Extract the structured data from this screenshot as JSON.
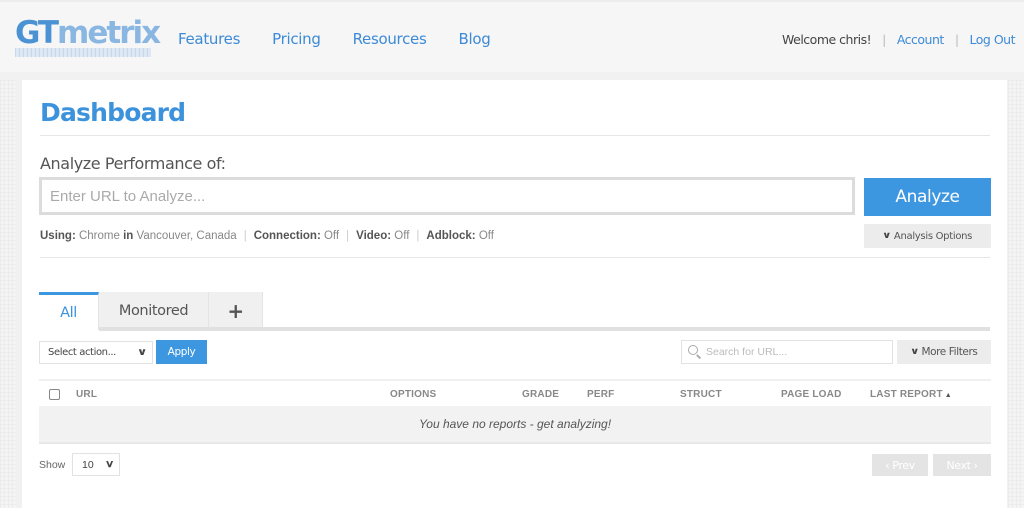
{
  "header": {
    "logo": {
      "part1": "GT",
      "part2": "metrix"
    },
    "nav": [
      "Features",
      "Pricing",
      "Resources",
      "Blog"
    ],
    "welcome": "Welcome chris!",
    "account_link": "Account",
    "logout_link": "Log Out",
    "separator": "|"
  },
  "page": {
    "title": "Dashboard",
    "analyze_label": "Analyze Performance of:",
    "url_placeholder": "Enter URL to Analyze...",
    "analyze_button": "Analyze",
    "analysis_options_button": "Analysis Options",
    "settings": {
      "using_label": "Using:",
      "browser": "Chrome",
      "in_label": "in",
      "location": "Vancouver, Canada",
      "connection_label": "Connection:",
      "connection_value": "Off",
      "video_label": "Video:",
      "video_value": "Off",
      "adblock_label": "Adblock:",
      "adblock_value": "Off"
    }
  },
  "tabs": [
    {
      "label": "All",
      "active": true
    },
    {
      "label": "Monitored",
      "active": false
    },
    {
      "label": "+",
      "active": false
    }
  ],
  "toolbar": {
    "action_select": "Select action...",
    "apply_button": "Apply",
    "search_placeholder": "Search for URL...",
    "more_filters_button": "More Filters"
  },
  "table": {
    "columns": [
      "URL",
      "OPTIONS",
      "GRADE",
      "PERF",
      "STRUCT",
      "PAGE LOAD",
      "LAST REPORT"
    ],
    "sorted_column": "LAST REPORT",
    "sort_direction": "ascending",
    "empty_message": "You have no reports - get analyzing!"
  },
  "footer": {
    "show_label": "Show",
    "page_size": "10",
    "prev_button": "Prev",
    "next_button": "Next"
  },
  "colors": {
    "brand_blue": "#3d97e0",
    "link_blue": "#3d8ad6"
  }
}
